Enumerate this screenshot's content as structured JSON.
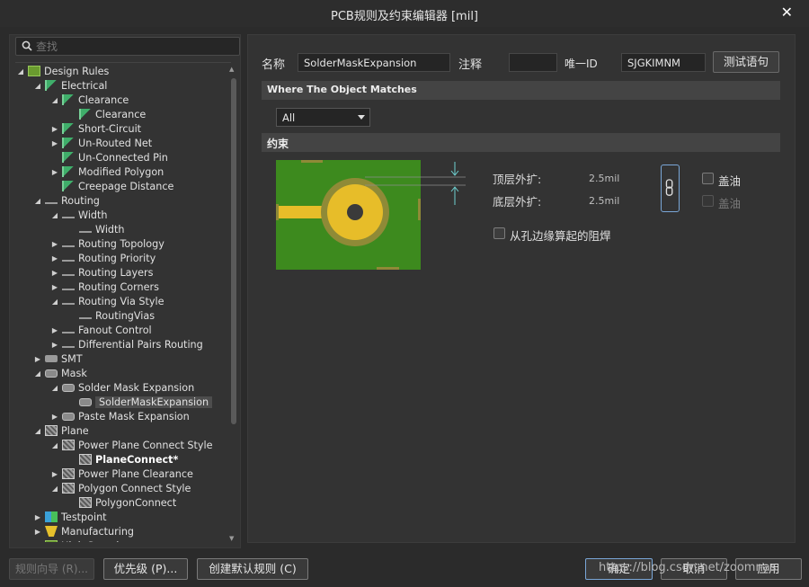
{
  "window": {
    "title": "PCB规则及约束编辑器 [mil]",
    "close_glyph": "✕"
  },
  "search": {
    "placeholder": "查找"
  },
  "tree": [
    {
      "label": "Design Rules",
      "arrow": "◢",
      "icon": "ico-rules",
      "level": 0
    },
    {
      "label": "Electrical",
      "arrow": "◢",
      "icon": "ico-elec",
      "level": 1
    },
    {
      "label": "Clearance",
      "arrow": "◢",
      "icon": "ico-elec",
      "level": 2
    },
    {
      "label": "Clearance",
      "arrow": "",
      "icon": "ico-elec",
      "level": 3
    },
    {
      "label": "Short-Circuit",
      "arrow": "▶",
      "icon": "ico-elec",
      "level": 2
    },
    {
      "label": "Un-Routed Net",
      "arrow": "▶",
      "icon": "ico-elec",
      "level": 2
    },
    {
      "label": "Un-Connected Pin",
      "arrow": "",
      "icon": "ico-elec",
      "level": 2
    },
    {
      "label": "Modified Polygon",
      "arrow": "▶",
      "icon": "ico-elec",
      "level": 2
    },
    {
      "label": "Creepage Distance",
      "arrow": "",
      "icon": "ico-elec",
      "level": 2
    },
    {
      "label": "Routing",
      "arrow": "◢",
      "icon": "ico-route",
      "level": 1
    },
    {
      "label": "Width",
      "arrow": "◢",
      "icon": "ico-route",
      "level": 2
    },
    {
      "label": "Width",
      "arrow": "",
      "icon": "ico-route",
      "level": 3
    },
    {
      "label": "Routing Topology",
      "arrow": "▶",
      "icon": "ico-route",
      "level": 2
    },
    {
      "label": "Routing Priority",
      "arrow": "▶",
      "icon": "ico-route",
      "level": 2
    },
    {
      "label": "Routing Layers",
      "arrow": "▶",
      "icon": "ico-route",
      "level": 2
    },
    {
      "label": "Routing Corners",
      "arrow": "▶",
      "icon": "ico-route",
      "level": 2
    },
    {
      "label": "Routing Via Style",
      "arrow": "◢",
      "icon": "ico-route",
      "level": 2
    },
    {
      "label": "RoutingVias",
      "arrow": "",
      "icon": "ico-route",
      "level": 3
    },
    {
      "label": "Fanout Control",
      "arrow": "▶",
      "icon": "ico-route",
      "level": 2
    },
    {
      "label": "Differential Pairs Routing",
      "arrow": "▶",
      "icon": "ico-route",
      "level": 2
    },
    {
      "label": "SMT",
      "arrow": "▶",
      "icon": "ico-smt",
      "level": 1
    },
    {
      "label": "Mask",
      "arrow": "◢",
      "icon": "ico-mask",
      "level": 1
    },
    {
      "label": "Solder Mask Expansion",
      "arrow": "◢",
      "icon": "ico-mask",
      "level": 2
    },
    {
      "label": "SolderMaskExpansion",
      "arrow": "",
      "icon": "ico-mask",
      "level": 3,
      "selected": true
    },
    {
      "label": "Paste Mask Expansion",
      "arrow": "▶",
      "icon": "ico-mask",
      "level": 2
    },
    {
      "label": "Plane",
      "arrow": "◢",
      "icon": "ico-plane",
      "level": 1
    },
    {
      "label": "Power Plane Connect Style",
      "arrow": "◢",
      "icon": "ico-plane",
      "level": 2
    },
    {
      "label": "PlaneConnect*",
      "arrow": "",
      "icon": "ico-plane",
      "level": 3,
      "bold": true
    },
    {
      "label": "Power Plane Clearance",
      "arrow": "▶",
      "icon": "ico-plane",
      "level": 2
    },
    {
      "label": "Polygon Connect Style",
      "arrow": "◢",
      "icon": "ico-plane",
      "level": 2
    },
    {
      "label": "PolygonConnect",
      "arrow": "",
      "icon": "ico-plane",
      "level": 3
    },
    {
      "label": "Testpoint",
      "arrow": "▶",
      "icon": "ico-test",
      "level": 1
    },
    {
      "label": "Manufacturing",
      "arrow": "▶",
      "icon": "ico-mfg",
      "level": 1
    },
    {
      "label": "High Speed",
      "arrow": "",
      "icon": "ico-rules",
      "level": 1
    }
  ],
  "rule": {
    "name_label": "名称",
    "name_value": "SolderMaskExpansion",
    "comment_label": "注释",
    "comment_value": "",
    "id_label": "唯一ID",
    "id_value": "SJGKIMNM",
    "test_button": "测试语句",
    "where_header": "Where The Object Matches",
    "scope_value": "All",
    "constraints_header": "约束",
    "top_label": "顶层外扩:",
    "top_value": "2.5mil",
    "bottom_label": "底层外扩:",
    "bottom_value": "2.5mil",
    "top_tent_label": "盖油",
    "bottom_tent_label": "盖油",
    "from_hole_label": "从孔边缘算起的阻焊"
  },
  "buttons": {
    "wizard": "规则向导 (R)...",
    "priority": "优先级 (P)...",
    "create_default": "创建默认规则 (C)",
    "ok": "确定",
    "cancel": "取消",
    "apply": "应用"
  },
  "watermark": "https://blog.csdn.net/zoomnas",
  "colors": {
    "pcb_board": "#3d8a1e",
    "pad_copper": "#e7bd29",
    "mask_ring": "#8f8a37"
  }
}
